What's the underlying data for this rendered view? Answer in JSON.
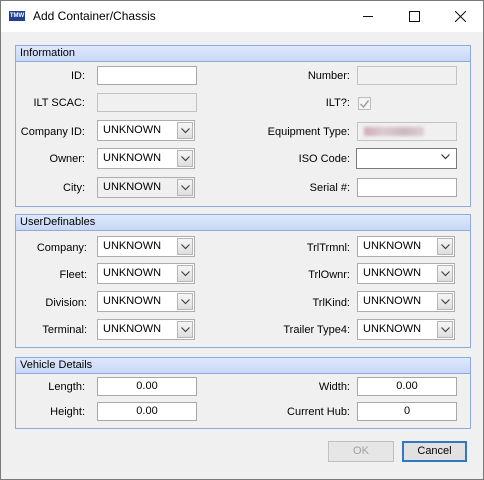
{
  "window": {
    "title": "Add Container/Chassis",
    "minimize_icon": "minimize-icon",
    "maximize_icon": "maximize-icon",
    "close_icon": "close-icon"
  },
  "information": {
    "header": "Information",
    "id_label": "ID:",
    "id_value": "",
    "ilt_scac_label": "ILT SCAC:",
    "ilt_scac_value": "",
    "company_id_label": "Company ID:",
    "company_id_value": "UNKNOWN",
    "owner_label": "Owner:",
    "owner_value": "UNKNOWN",
    "city_label": "City:",
    "city_value": "UNKNOWN",
    "number_label": "Number:",
    "number_value": "",
    "ilt_label": "ILT?:",
    "ilt_checked": true,
    "equipment_type_label": "Equipment Type:",
    "iso_code_label": "ISO Code:",
    "iso_code_value": "",
    "serial_label": "Serial #:",
    "serial_value": ""
  },
  "user_definables": {
    "header": "UserDefinables",
    "company_label": "Company:",
    "company_value": "UNKNOWN",
    "fleet_label": "Fleet:",
    "fleet_value": "UNKNOWN",
    "division_label": "Division:",
    "division_value": "UNKNOWN",
    "terminal_label": "Terminal:",
    "terminal_value": "UNKNOWN",
    "trltrmnl_label": "TrlTrmnl:",
    "trltrmnl_value": "UNKNOWN",
    "trlownr_label": "TrlOwnr:",
    "trlownr_value": "UNKNOWN",
    "trlkind_label": "TrlKind:",
    "trlkind_value": "UNKNOWN",
    "trailer_type4_label": "Trailer Type4:",
    "trailer_type4_value": "UNKNOWN"
  },
  "vehicle_details": {
    "header": "Vehicle Details",
    "length_label": "Length:",
    "length_value": "0.00",
    "height_label": "Height:",
    "height_value": "0.00",
    "width_label": "Width:",
    "width_value": "0.00",
    "current_hub_label": "Current Hub:",
    "current_hub_value": "0"
  },
  "buttons": {
    "ok": "OK",
    "cancel": "Cancel"
  }
}
